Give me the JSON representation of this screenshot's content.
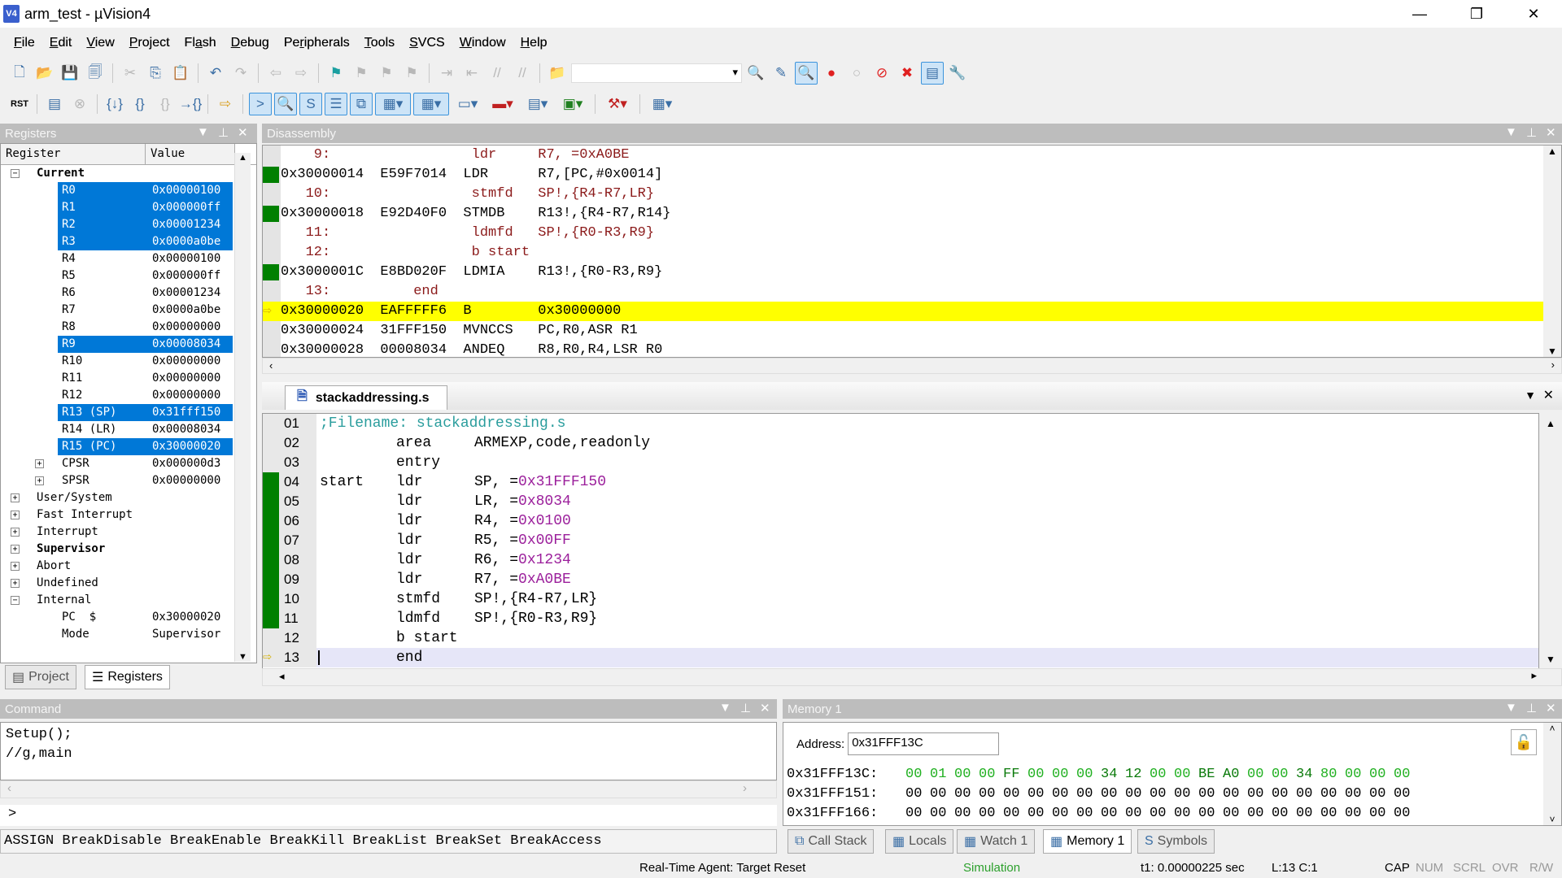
{
  "window": {
    "title": "arm_test  - µVision4",
    "app_icon": "V4"
  },
  "menu": [
    {
      "label": "File",
      "u": "F",
      "rest": "ile"
    },
    {
      "label": "Edit",
      "u": "E",
      "rest": "dit"
    },
    {
      "label": "View",
      "u": "V",
      "rest": "iew"
    },
    {
      "label": "Project",
      "u": "P",
      "rest": "roject"
    },
    {
      "label": "Flash",
      "pre": "Fl",
      "u": "a",
      "rest": "sh"
    },
    {
      "label": "Debug",
      "u": "D",
      "rest": "ebug"
    },
    {
      "label": "Peripherals",
      "pre": "Pe",
      "u": "r",
      "rest": "ipherals"
    },
    {
      "label": "Tools",
      "u": "T",
      "rest": "ools"
    },
    {
      "label": "SVCS",
      "u": "S",
      "rest": "VCS"
    },
    {
      "label": "Window",
      "u": "W",
      "rest": "indow"
    },
    {
      "label": "Help",
      "u": "H",
      "rest": "elp"
    }
  ],
  "registers": {
    "title": "Registers",
    "col_register": "Register",
    "col_value": "Value",
    "rows": [
      {
        "label": "Current",
        "value": "",
        "level": 0,
        "exp": "−",
        "bold": true
      },
      {
        "label": "R0",
        "value": "0x00000100",
        "level": 2,
        "sel": true
      },
      {
        "label": "R1",
        "value": "0x000000ff",
        "level": 2,
        "sel": true
      },
      {
        "label": "R2",
        "value": "0x00001234",
        "level": 2,
        "sel": true
      },
      {
        "label": "R3",
        "value": "0x0000a0be",
        "level": 2,
        "sel": true
      },
      {
        "label": "R4",
        "value": "0x00000100",
        "level": 2
      },
      {
        "label": "R5",
        "value": "0x000000ff",
        "level": 2
      },
      {
        "label": "R6",
        "value": "0x00001234",
        "level": 2
      },
      {
        "label": "R7",
        "value": "0x0000a0be",
        "level": 2
      },
      {
        "label": "R8",
        "value": "0x00000000",
        "level": 2
      },
      {
        "label": "R9",
        "value": "0x00008034",
        "level": 2,
        "sel": true
      },
      {
        "label": "R10",
        "value": "0x00000000",
        "level": 2
      },
      {
        "label": "R11",
        "value": "0x00000000",
        "level": 2
      },
      {
        "label": "R12",
        "value": "0x00000000",
        "level": 2
      },
      {
        "label": "R13 (SP)",
        "value": "0x31fff150",
        "level": 2,
        "sel": true
      },
      {
        "label": "R14 (LR)",
        "value": "0x00008034",
        "level": 2
      },
      {
        "label": "R15 (PC)",
        "value": "0x30000020",
        "level": 2,
        "sel": true
      },
      {
        "label": "CPSR",
        "value": "0x000000d3",
        "level": 1,
        "exp": "+"
      },
      {
        "label": "SPSR",
        "value": "0x00000000",
        "level": 1,
        "exp": "+"
      },
      {
        "label": "User/System",
        "value": "",
        "level": 0,
        "exp": "+"
      },
      {
        "label": "Fast Interrupt",
        "value": "",
        "level": 0,
        "exp": "+"
      },
      {
        "label": "Interrupt",
        "value": "",
        "level": 0,
        "exp": "+"
      },
      {
        "label": "Supervisor",
        "value": "",
        "level": 0,
        "exp": "+",
        "bold": true
      },
      {
        "label": "Abort",
        "value": "",
        "level": 0,
        "exp": "+"
      },
      {
        "label": "Undefined",
        "value": "",
        "level": 0,
        "exp": "+"
      },
      {
        "label": "Internal",
        "value": "",
        "level": 0,
        "exp": "−"
      },
      {
        "label": "PC  $",
        "value": "0x30000020",
        "level": 2
      },
      {
        "label": "Mode",
        "value": "Supervisor",
        "level": 2
      }
    ],
    "tabs": [
      "Project",
      "Registers"
    ]
  },
  "disassembly": {
    "title": "Disassembly",
    "lines": [
      {
        "type": "src",
        "text": "    9:                 ldr     R7, =0xA0BE"
      },
      {
        "type": "asm",
        "text": "0x30000014  E59F7014  LDR      R7,[PC,#0x0014]",
        "exec": true
      },
      {
        "type": "src",
        "text": "   10:                 stmfd   SP!,{R4-R7,LR}"
      },
      {
        "type": "asm",
        "text": "0x30000018  E92D40F0  STMDB    R13!,{R4-R7,R14}",
        "exec": true
      },
      {
        "type": "src",
        "text": "   11:                 ldmfd   SP!,{R0-R3,R9}"
      },
      {
        "type": "src",
        "text": "   12:                 b start"
      },
      {
        "type": "asm",
        "text": "0x3000001C  E8BD020F  LDMIA    R13!,{R0-R3,R9}",
        "exec": true
      },
      {
        "type": "src",
        "text": "   13:          end"
      },
      {
        "type": "asm",
        "text": "0x30000020  EAFFFFF6  B        0x30000000",
        "current": true
      },
      {
        "type": "asm",
        "text": "0x30000024  31FFF150  MVNCCS   PC,R0,ASR R1"
      },
      {
        "type": "asm",
        "text": "0x30000028  00008034  ANDEQ    R8,R0,R4,LSR R0"
      }
    ]
  },
  "editor": {
    "tab": "stackaddressing.s",
    "lines": [
      {
        "n": "01",
        "comment": ";Filename: stackaddressing.s"
      },
      {
        "n": "02",
        "ins": "area",
        "ops": "ARMEXP,code,readonly"
      },
      {
        "n": "03",
        "ins": "entry"
      },
      {
        "n": "04",
        "label": "start",
        "ins": "ldr",
        "ops": "SP, =",
        "imm": "0x31FFF150",
        "exec": true
      },
      {
        "n": "05",
        "ins": "ldr",
        "ops": "LR, =",
        "imm": "0x8034",
        "exec": true
      },
      {
        "n": "06",
        "ins": "ldr",
        "ops": "R4, =",
        "imm": "0x0100",
        "exec": true
      },
      {
        "n": "07",
        "ins": "ldr",
        "ops": "R5, =",
        "imm": "0x00FF",
        "exec": true
      },
      {
        "n": "08",
        "ins": "ldr",
        "ops": "R6, =",
        "imm": "0x1234",
        "exec": true
      },
      {
        "n": "09",
        "ins": "ldr",
        "ops": "R7, =",
        "imm": "0xA0BE",
        "exec": true
      },
      {
        "n": "10",
        "ins": "stmfd",
        "ops": "SP!,{R4-R7,LR}",
        "exec": true
      },
      {
        "n": "11",
        "ins": "ldmfd",
        "ops": "SP!,{R0-R3,R9}",
        "exec": true
      },
      {
        "n": "12",
        "ins": "b start"
      },
      {
        "n": "13",
        "ins": "end",
        "current": true
      }
    ]
  },
  "command": {
    "title": "Command",
    "output": [
      "Setup();",
      "//g,main"
    ],
    "prompt": ">",
    "hints": "ASSIGN BreakDisable BreakEnable BreakKill BreakList BreakSet BreakAccess"
  },
  "memory": {
    "title": "Memory 1",
    "address_label": "Address:",
    "address_value": "0x31FFF13C",
    "rows": [
      {
        "addr": "0x31FFF13C:",
        "bytes": [
          "00",
          "01",
          "00",
          "00",
          "FF",
          "00",
          "00",
          "00",
          "34",
          "12",
          "00",
          "00",
          "BE",
          "A0",
          "00",
          "00",
          "34",
          "80",
          "00",
          "00",
          "00"
        ],
        "changed": true
      },
      {
        "addr": "0x31FFF151:",
        "bytes": [
          "00",
          "00",
          "00",
          "00",
          "00",
          "00",
          "00",
          "00",
          "00",
          "00",
          "00",
          "00",
          "00",
          "00",
          "00",
          "00",
          "00",
          "00",
          "00",
          "00",
          "00"
        ]
      },
      {
        "addr": "0x31FFF166:",
        "bytes": [
          "00",
          "00",
          "00",
          "00",
          "00",
          "00",
          "00",
          "00",
          "00",
          "00",
          "00",
          "00",
          "00",
          "00",
          "00",
          "00",
          "00",
          "00",
          "00",
          "00",
          "00"
        ]
      }
    ],
    "tabs": [
      "Call Stack",
      "Locals",
      "Watch 1",
      "Memory 1",
      "Symbols"
    ]
  },
  "status": {
    "agent": "Real-Time Agent: Target Reset",
    "mode": "Simulation",
    "time": "t1: 0.00000225 sec",
    "pos": "L:13 C:1",
    "caps": "CAP",
    "num": "NUM",
    "scrl": "SCRL",
    "ovr": "OVR",
    "rw": "R/W"
  },
  "colors": {
    "exec": "#008000",
    "current_line": "#ffff00",
    "selection": "#0078d7",
    "simulation": "#2ca02c"
  }
}
